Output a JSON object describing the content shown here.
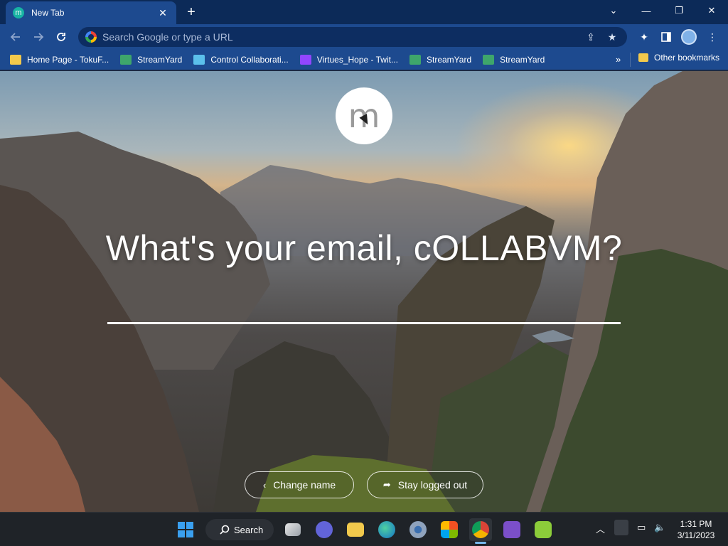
{
  "browser": {
    "tab": {
      "title": "New Tab",
      "favicon": "m",
      "close": "✕"
    },
    "new_tab": "+",
    "window_controls": {
      "tabsearch": "⌄",
      "minimize": "—",
      "restore": "❐",
      "close": "✕"
    },
    "omnibox": {
      "placeholder": "Search Google or type a URL"
    },
    "bookmarks": [
      {
        "label": "Home Page - TokuF...",
        "color": "#f2c94c"
      },
      {
        "label": "StreamYard",
        "color": "#3ea66b"
      },
      {
        "label": "Control Collaborati...",
        "color": "#5bc0eb"
      },
      {
        "label": "Virtues_Hope - Twit...",
        "color": "#9146ff"
      },
      {
        "label": "StreamYard",
        "color": "#3ea66b"
      },
      {
        "label": "StreamYard",
        "color": "#3ea66b"
      }
    ],
    "bookmarks_more": "»",
    "other_bookmarks": "Other bookmarks"
  },
  "page": {
    "avatar_letter": "m",
    "question": "What's your email, cOLLABVM?",
    "email_value": "",
    "change_name_label": "Change name",
    "stay_logged_out_label": "Stay logged out"
  },
  "taskbar": {
    "search_label": "Search",
    "time": "1:31 PM",
    "date": "3/11/2023"
  }
}
